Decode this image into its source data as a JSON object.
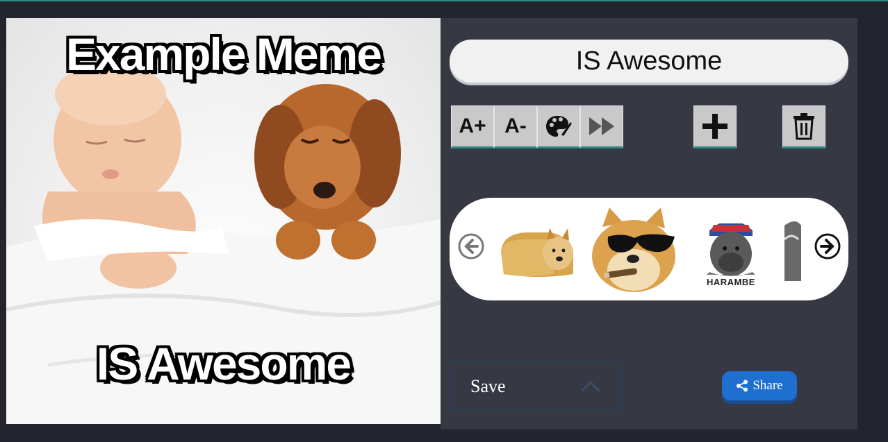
{
  "meme": {
    "top_text": "Example Meme",
    "bottom_text": "IS Awesome"
  },
  "editor": {
    "text_value": "IS Awesome",
    "tools": {
      "increase_font": "A+",
      "decrease_font": "A-"
    }
  },
  "stickers": {
    "items": [
      {
        "name": "doge-bread"
      },
      {
        "name": "doge-sunglasses-cigar"
      },
      {
        "name": "harambe",
        "caption": "HARAMBE"
      },
      {
        "name": "partial-sticker"
      }
    ]
  },
  "actions": {
    "save_label": "Save",
    "share_label": "Share"
  },
  "colors": {
    "background": "#22252d",
    "panel": "#363943",
    "tool_button": "#c9c9c9",
    "tool_accent": "#2c8a88",
    "share_button": "#1e6fd0"
  }
}
